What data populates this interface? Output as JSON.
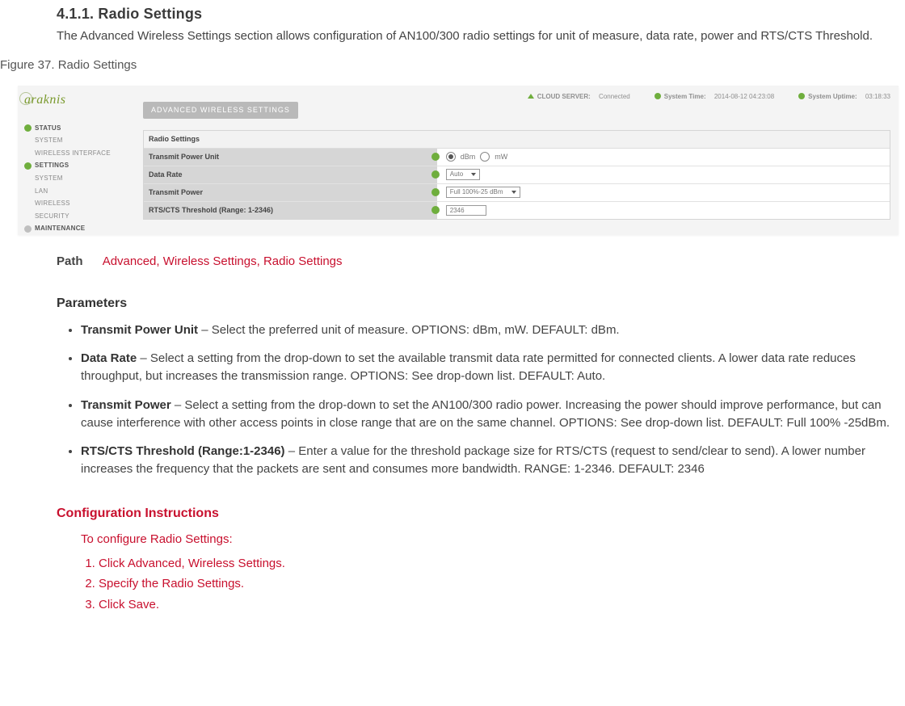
{
  "heading": "4.1.1. Radio Settings",
  "intro": "The Advanced Wireless Settings section allows configuration of AN100/300 radio settings for unit of measure, data rate, power and RTS/CTS Threshold.",
  "figure_caption": "Figure 37. Radio Settings",
  "shot": {
    "logo": "araknis",
    "header_bar": "ADVANCED WIRELESS SETTINGS",
    "status": {
      "cloud_k": "CLOUD SERVER:",
      "cloud_v": "Connected",
      "time_k": "System Time:",
      "time_v": "2014-08-12 04:23:08",
      "uptime_k": "System Uptime:",
      "uptime_v": "03:18:33"
    },
    "sidebar": {
      "status": "STATUS",
      "status_items": [
        "SYSTEM",
        "WIRELESS INTERFACE"
      ],
      "settings": "SETTINGS",
      "settings_items": [
        "SYSTEM",
        "LAN",
        "WIRELESS",
        "SECURITY"
      ],
      "maint": "MAINTENANCE"
    },
    "table": {
      "title": "Radio Settings",
      "rows": [
        {
          "label": "Transmit Power Unit",
          "opt1": "dBm",
          "opt2": "mW"
        },
        {
          "label": "Data Rate",
          "val": "Auto"
        },
        {
          "label": "Transmit Power",
          "val": "Full 100%-25 dBm"
        },
        {
          "label": "RTS/CTS Threshold (Range: 1-2346)",
          "val": "2346"
        }
      ]
    }
  },
  "path": {
    "k": "Path",
    "v": "Advanced, Wireless Settings, Radio Settings"
  },
  "params_h": "Parameters",
  "params": [
    {
      "k": "Transmit Power Unit",
      "d": " – Select the preferred unit of measure. OPTIONS: dBm, mW. DEFAULT: dBm."
    },
    {
      "k": "Data Rate",
      "d": " – Select a setting from the drop-down to set the available transmit data rate permitted for connected clients. A lower data rate reduces throughput, but increases the transmission range. OPTIONS: See drop-down list. DEFAULT: Auto."
    },
    {
      "k": "Transmit Power",
      "d": " – Select a setting from the drop-down to set the AN100/300 radio power. Increasing the power should improve performance, but can cause interference with other access points in close range that are on the same channel. OPTIONS: See drop-down list. DEFAULT: Full 100% -25dBm."
    },
    {
      "k": "RTS/CTS Threshold (Range:1-2346)",
      "d": " – Enter a value for the threshold package size for RTS/CTS (request to send/clear to send). A lower number increases the frequency that the packets are sent and consumes more bandwidth. RANGE: 1-2346. DEFAULT: 2346"
    }
  ],
  "conf_h": "Configuration Instructions",
  "conf_intro": "To configure Radio Settings:",
  "conf_steps": [
    "Click Advanced, Wireless Settings.",
    "Specify the Radio Settings.",
    "Click Save."
  ]
}
